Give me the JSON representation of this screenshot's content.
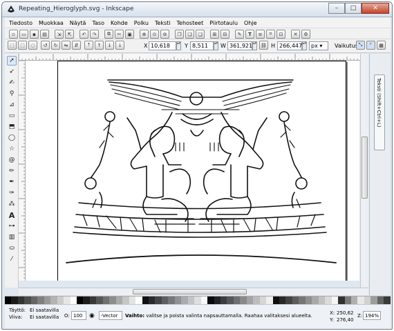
{
  "window": {
    "title": "Repeating_Hieroglyph.svg - Inkscape",
    "buttons": {
      "minimize": "–",
      "maximize": "□",
      "close": "✕"
    }
  },
  "menubar": [
    "Tiedosto",
    "Muokkaa",
    "Näytä",
    "Taso",
    "Kohde",
    "Polku",
    "Teksti",
    "Tehosteet",
    "Piirtotaulu",
    "Ohje"
  ],
  "toolbar_selection": {
    "x_label": "X",
    "x_value": "10,618",
    "y_label": "Y",
    "y_value": "8,511",
    "w_label": "W",
    "w_value": "361,921",
    "h_label": "H",
    "h_value": "266,447",
    "unit": "px",
    "affect_label": "Vaikutus:"
  },
  "docked_dialog": {
    "tab_label": "Teksti (Shift+Ctrl+L)"
  },
  "statusbar": {
    "fill_label": "Täyttö:",
    "fill_value": "Ei saatavilla",
    "stroke_label": "Viiva:",
    "stroke_value": "Ei saatavilla",
    "opacity_label": "O:",
    "opacity_value": "100",
    "layer_value": "-Vector",
    "message_bold": "Vaihto:",
    "message": " valitse ja poista valinta napsauttamalla. Raahaa valitaksesi alueelta.",
    "cursor_x_label": "X:",
    "cursor_x": "250,62",
    "cursor_y_label": "Y:",
    "cursor_y": "276,40",
    "zoom_label": "Z:",
    "zoom_value": "194%"
  },
  "palette_colors": [
    "#000000",
    "#1a1a1a",
    "#333333",
    "#4d4d4d",
    "#666666",
    "#808080",
    "#999999",
    "#b3b3b3",
    "#cccccc",
    "#e6e6e6",
    "#ffffff",
    "#000000",
    "#1c1c1c",
    "#383838",
    "#555555",
    "#717171",
    "#8d8d8d",
    "#aaaaaa",
    "#c6c6c6",
    "#e2e2e2",
    "#ffffff",
    "#111111",
    "#2a2a2a",
    "#444444",
    "#5e5e5e",
    "#777777",
    "#919191",
    "#ababab",
    "#c4c4c4",
    "#dedede",
    "#f8f8f8",
    "#090909",
    "#222222",
    "#3c3c3c",
    "#565656",
    "#6f6f6f",
    "#898989",
    "#a3a3a3",
    "#bcbcbc",
    "#d6d6d6",
    "#efefef",
    "#0f0f0f",
    "#292929",
    "#424242",
    "#5c5c5c",
    "#757575",
    "#8f8f8f",
    "#a8a8a8",
    "#c2c2c2",
    "#dbdbdb",
    "#f5f5f5",
    "#303030",
    "#7a7a7a",
    "#b0b0b0",
    "#e8e8e8",
    "#d1d1d1",
    "#9d9d9d",
    "#646464",
    "#3a3a3a"
  ]
}
